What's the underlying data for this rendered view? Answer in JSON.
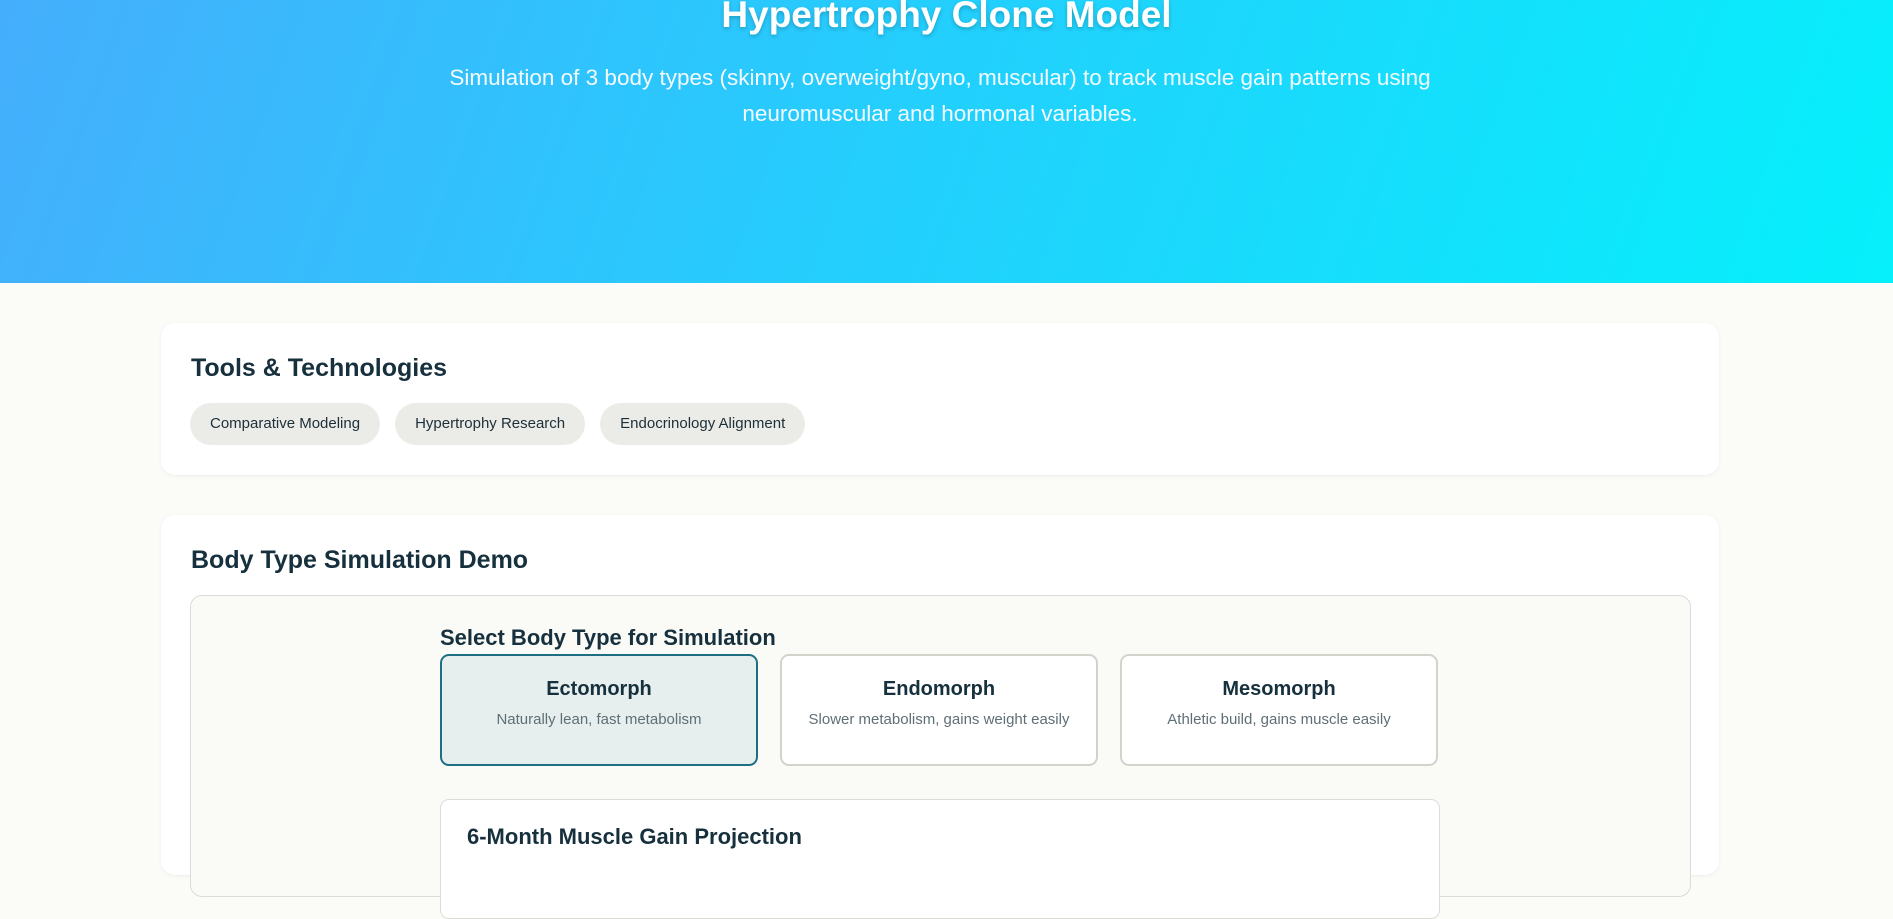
{
  "hero": {
    "title": "Hypertrophy Clone Model",
    "subtitle": "Simulation of 3 body types (skinny, overweight/gyno, muscular) to track muscle gain patterns using neuromuscular and hormonal variables."
  },
  "tools": {
    "heading": "Tools & Technologies",
    "chips": [
      "Comparative Modeling",
      "Hypertrophy Research",
      "Endocrinology Alignment"
    ]
  },
  "demo": {
    "heading": "Body Type Simulation Demo",
    "select_title": "Select Body Type for Simulation",
    "body_types": [
      {
        "name": "Ectomorph",
        "description": "Naturally lean, fast metabolism"
      },
      {
        "name": "Endomorph",
        "description": "Slower metabolism, gains weight easily"
      },
      {
        "name": "Mesomorph",
        "description": "Athletic build, gains muscle easily"
      }
    ],
    "selected": "Ectomorph",
    "projection_title": "6-Month Muscle Gain Projection"
  },
  "colors": {
    "hero_gradient_start": "#45aefc",
    "hero_gradient_end": "#05f0fb",
    "accent": "#1f6f84"
  }
}
